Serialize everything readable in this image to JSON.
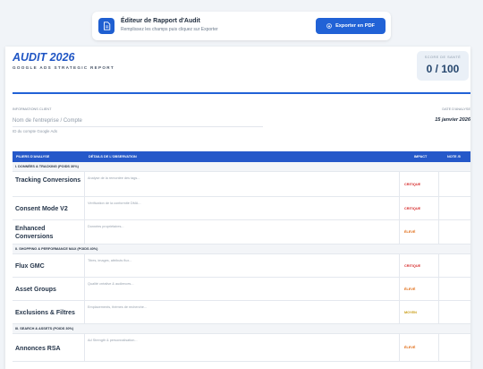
{
  "toolbar": {
    "title": "Éditeur de Rapport d'Audit",
    "subtitle": "Remplissez les champs puis cliquez sur Exporter",
    "export_label": "Exporter en PDF"
  },
  "report": {
    "title": "AUDIT 2026",
    "subtitle": "GOOGLE ADS STRATEGIC REPORT",
    "score_label": "SCORE DE SANTÉ",
    "score_value": "0 / 100",
    "client_label": "INFORMATIONS CLIENT",
    "company_placeholder": "Nom de l'entreprise / Compte",
    "account_id_placeholder": "ID du compte Google Ads",
    "date_label": "DATE D'ANALYSE",
    "date_value": "15 janvier 2026"
  },
  "table": {
    "headers": {
      "pillars": "PILIERS D'ANALYSE",
      "details": "DÉTAILS DE L'OBSERVATION",
      "impact": "IMPACT",
      "score": "NOTE /5"
    },
    "sections": [
      {
        "title": "I. DONNÉES & TRACKING (POIDS 30%)",
        "rows": [
          {
            "name": "Tracking Conversions",
            "detail": "Analyse de la remontée des tags...",
            "impact": "CRITIQUE",
            "impact_color": "#d62c2c"
          },
          {
            "name": "Consent Mode V2",
            "detail": "Vérification de la conformité DMA...",
            "impact": "CRITIQUE",
            "impact_color": "#d62c2c"
          },
          {
            "name": "Enhanced Conversions",
            "detail": "Données propriétaires...",
            "impact": "ÉLEVÉ",
            "impact_color": "#e06a12"
          }
        ]
      },
      {
        "title": "II. SHOPPING & PERFORMANCE MAX (POIDS 40%)",
        "rows": [
          {
            "name": "Flux GMC",
            "detail": "Titres, images, attributs flux...",
            "impact": "CRITIQUE",
            "impact_color": "#d62c2c"
          },
          {
            "name": "Asset Groups",
            "detail": "Qualité créative & audiences...",
            "impact": "ÉLEVÉ",
            "impact_color": "#e06a12"
          },
          {
            "name": "Exclusions & Filtres",
            "detail": "Emplacements, thèmes de recherche...",
            "impact": "MOYEN",
            "impact_color": "#c79a10"
          }
        ]
      },
      {
        "title": "III. SEARCH & ASSETS (POIDS 30%)",
        "rows": [
          {
            "name": "Annonces RSA",
            "detail": "Ad Strength & personnalisation...",
            "impact": "ÉLEVÉ",
            "impact_color": "#e06a12"
          }
        ]
      }
    ]
  }
}
